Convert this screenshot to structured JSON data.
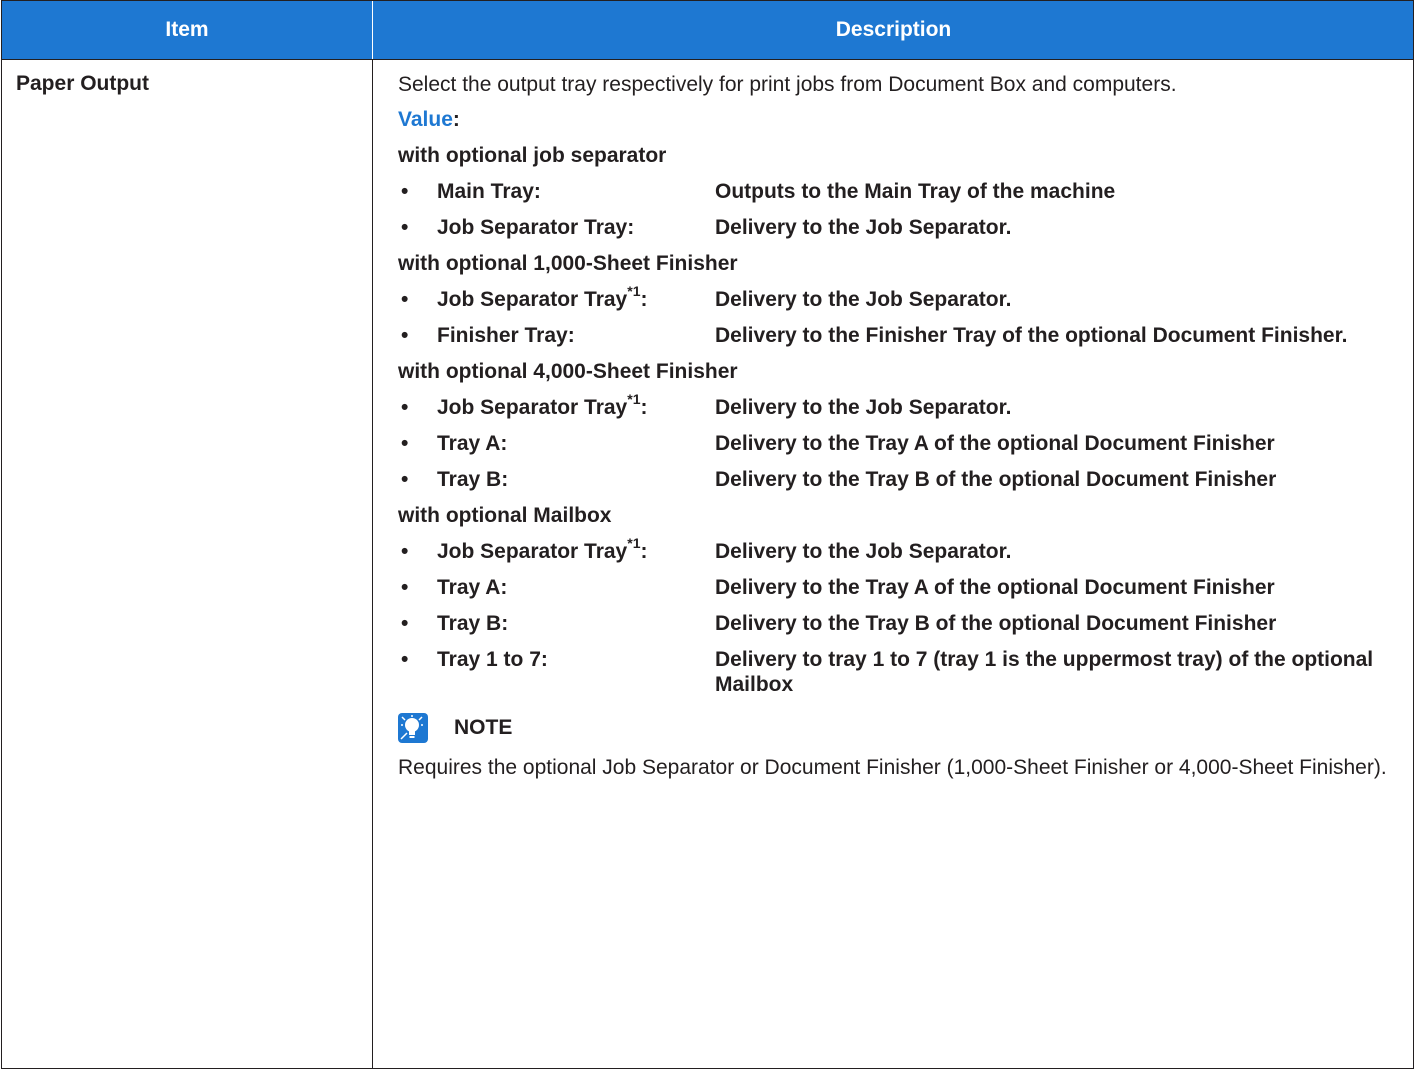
{
  "header": {
    "item": "Item",
    "description": "Description"
  },
  "row": {
    "item": "Paper Output",
    "intro": "Select the output tray respectively for print jobs from Document Box and computers.",
    "value_label": "Value",
    "value_colon": ":",
    "groups": [
      {
        "title": "with optional job separator",
        "options": [
          {
            "name": "Main Tray:",
            "desc": "Outputs to the Main Tray of the machine"
          },
          {
            "name": "Job Separator Tray:",
            "desc": "Delivery to the Job Separator."
          }
        ]
      },
      {
        "title": "with optional 1,000-Sheet Finisher",
        "options": [
          {
            "name": "Job Separator Tray",
            "sup": "*1",
            "suffix": ":",
            "desc": "Delivery to the Job Separator."
          },
          {
            "name": "Finisher Tray:",
            "desc": "Delivery to the Finisher Tray of the optional Document Finisher."
          }
        ]
      },
      {
        "title": "with optional 4,000-Sheet Finisher",
        "options": [
          {
            "name": "Job Separator Tray",
            "sup": "*1",
            "suffix": ":",
            "desc": "Delivery to the Job Separator."
          },
          {
            "name": "Tray A:",
            "desc": "Delivery to the Tray A of the optional Document Finisher"
          },
          {
            "name": "Tray B:",
            "desc": "Delivery to the Tray B of the optional Document Finisher"
          }
        ]
      },
      {
        "title": "with optional Mailbox",
        "options": [
          {
            "name": "Job Separator Tray",
            "sup": "*1",
            "suffix": ":",
            "desc": "Delivery to the Job Separator."
          },
          {
            "name": "Tray A:",
            "desc": "Delivery to the Tray A of the optional Document Finisher"
          },
          {
            "name": "Tray B:",
            "desc": "Delivery to the Tray B of the optional Document Finisher"
          },
          {
            "name": "Tray 1 to 7:",
            "desc": "Delivery to tray 1 to 7 (tray 1 is the uppermost tray) of the optional Mailbox"
          }
        ]
      }
    ],
    "bullet": "•",
    "note": {
      "label": "NOTE",
      "icon": "lightbulb-note-icon",
      "text": "Requires the optional Job Separator or Document Finisher (1,000-Sheet Finisher or 4,000-Sheet Finisher)."
    }
  },
  "colors": {
    "header_bg": "#1e78d2",
    "value_label": "#1e78d2",
    "text": "#231f20"
  }
}
